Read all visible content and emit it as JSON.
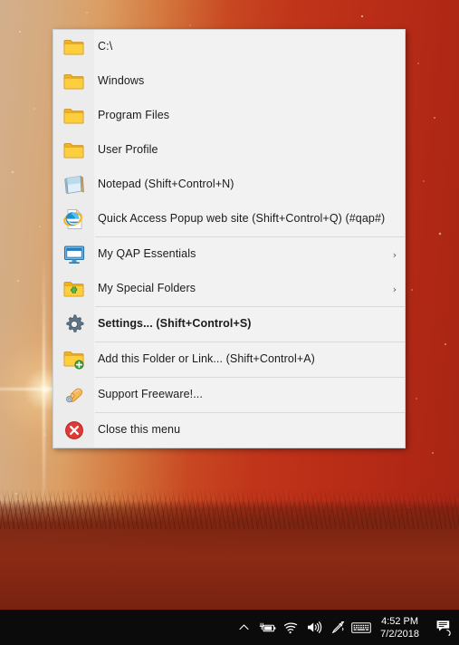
{
  "desktop": {
    "wallpaper_name": "starry-red-sky-grass-wallpaper",
    "colors": {
      "sky_left": "#d2a072",
      "sky_right": "#a82c18",
      "grass": "#7a2411",
      "taskbar": "#0b0b0b"
    }
  },
  "menu": {
    "name": "Quick Access Popup menu",
    "background": "#f2f2f2",
    "gutter_background": "#ececec",
    "border_color": "#cfcfcf",
    "items": [
      {
        "label": "C:\\",
        "icon": "folder-icon",
        "submenu": false,
        "bold": false,
        "separator_after": false
      },
      {
        "label": "Windows",
        "icon": "folder-icon",
        "submenu": false,
        "bold": false,
        "separator_after": false
      },
      {
        "label": "Program Files",
        "icon": "folder-icon",
        "submenu": false,
        "bold": false,
        "separator_after": false
      },
      {
        "label": "User Profile",
        "icon": "folder-icon",
        "submenu": false,
        "bold": false,
        "separator_after": false
      },
      {
        "label": "Notepad (Shift+Control+N)",
        "icon": "notepad-icon",
        "submenu": false,
        "bold": false,
        "separator_after": false
      },
      {
        "label": "Quick Access Popup web site (Shift+Control+Q) (#qap#)",
        "icon": "internet-explorer-icon",
        "submenu": false,
        "bold": false,
        "separator_after": true
      },
      {
        "label": "My QAP Essentials",
        "icon": "monitor-icon",
        "submenu": true,
        "bold": false,
        "separator_after": false
      },
      {
        "label": "My Special Folders",
        "icon": "special-folder-icon",
        "submenu": true,
        "bold": false,
        "separator_after": true
      },
      {
        "label": "Settings... (Shift+Control+S)",
        "icon": "gear-icon",
        "submenu": false,
        "bold": true,
        "separator_after": true
      },
      {
        "label": "Add this Folder or Link... (Shift+Control+A)",
        "icon": "folder-add-icon",
        "submenu": false,
        "bold": false,
        "separator_after": true
      },
      {
        "label": "Support Freeware!...",
        "icon": "donate-hand-icon",
        "submenu": false,
        "bold": false,
        "separator_after": true
      },
      {
        "label": "Close this menu",
        "icon": "close-circle-icon",
        "submenu": false,
        "bold": false,
        "separator_after": false
      }
    ],
    "submenu_glyph": "›"
  },
  "taskbar": {
    "tray_icons": [
      {
        "name": "show-hidden-icons-chevron-icon"
      },
      {
        "name": "battery-charging-icon"
      },
      {
        "name": "wifi-icon"
      },
      {
        "name": "volume-icon"
      },
      {
        "name": "pen-workspace-icon"
      },
      {
        "name": "touch-keyboard-icon"
      }
    ],
    "clock": {
      "time": "4:52 PM",
      "date": "7/2/2018"
    },
    "action_center": {
      "name": "action-center-icon"
    }
  }
}
